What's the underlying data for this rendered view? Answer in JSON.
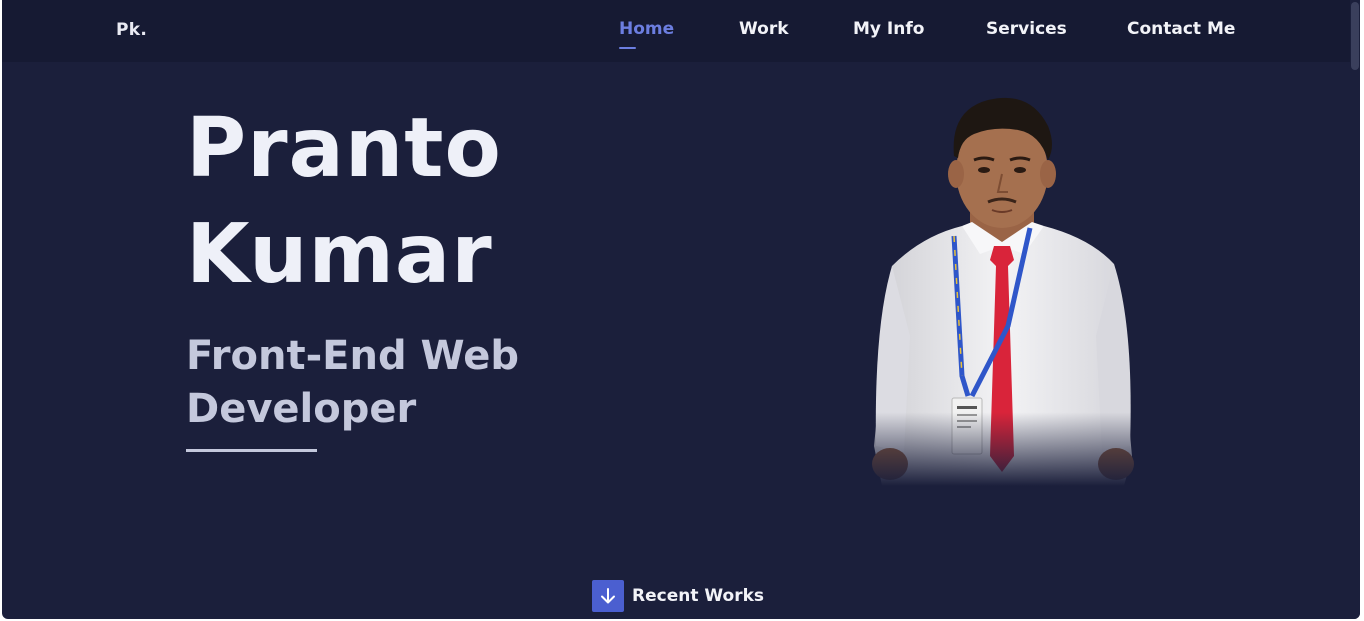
{
  "header": {
    "logo": "Pk."
  },
  "nav": {
    "items": [
      {
        "label": "Home",
        "active": true
      },
      {
        "label": "Work",
        "active": false
      },
      {
        "label": "My Info",
        "active": false
      },
      {
        "label": "Services",
        "active": false
      },
      {
        "label": "Contact Me",
        "active": false
      }
    ]
  },
  "hero": {
    "first_name": "Pranto",
    "last_name": "Kumar",
    "role_line1": "Front-End Web",
    "role_line2": "Developer",
    "photo_icon": "profile-photo"
  },
  "scroll_cta": {
    "label": "Recent Works",
    "icon": "arrow-down-icon"
  },
  "colors": {
    "background": "#1b1f3b",
    "navbar": "#161a33",
    "accent": "#6c7ee0",
    "button": "#4b5fd0",
    "text": "#eef0f8",
    "subtext": "#c4c8dc"
  }
}
